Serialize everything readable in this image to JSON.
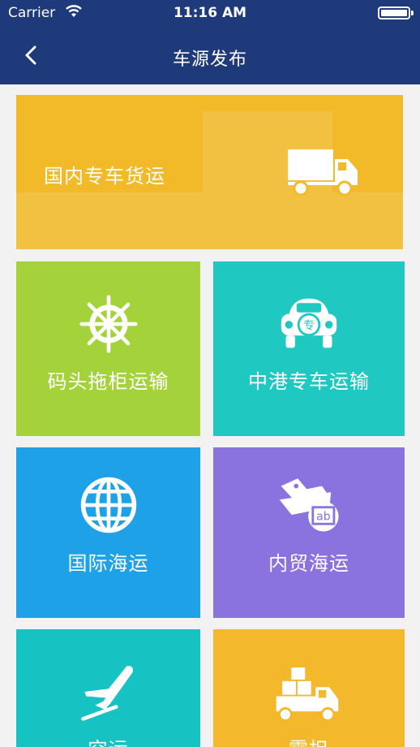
{
  "status_bar": {
    "carrier": "Carrier",
    "time": "11:16 AM"
  },
  "header": {
    "title": "车源发布",
    "back_icon": "chevron-left-icon",
    "background": "#1f3a7a"
  },
  "tiles": [
    {
      "label": "国内专车货运",
      "icon": "truck-icon",
      "color": "#f2b928"
    },
    {
      "label": "码头拖柜运输",
      "icon": "ship-wheel-icon",
      "color": "#a4d23a"
    },
    {
      "label": "中港专车运输",
      "icon": "special-car-icon",
      "color": "#1fc9c2"
    },
    {
      "label": "国际海运",
      "icon": "globe-icon",
      "color": "#1ea1e6"
    },
    {
      "label": "内贸海运",
      "icon": "cargo-ship-icon",
      "color": "#8a72df"
    },
    {
      "label": "空运",
      "icon": "airplane-icon",
      "color": "#17c2c2"
    },
    {
      "label": "零担",
      "icon": "boxes-truck-icon",
      "color": "#f3b82b"
    }
  ]
}
